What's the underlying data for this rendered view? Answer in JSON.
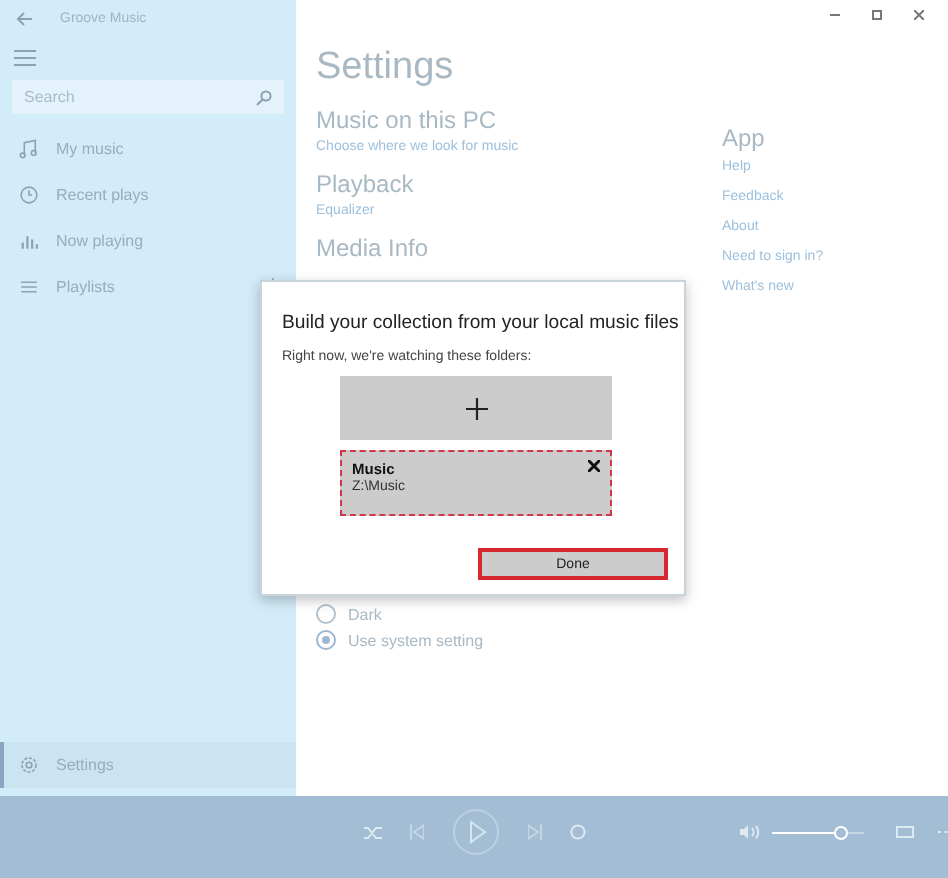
{
  "window": {
    "title": "Groove Music"
  },
  "sidebar": {
    "search": {
      "placeholder": "Search"
    },
    "items": [
      {
        "label": "My music",
        "selected": false
      },
      {
        "label": "Recent plays",
        "selected": false
      },
      {
        "label": "Now playing",
        "selected": false
      },
      {
        "label": "Playlists",
        "selected": false
      }
    ],
    "footer": {
      "label": "Settings",
      "selected": true
    }
  },
  "settings": {
    "heading": "Settings",
    "sections": [
      {
        "title": "Music on this PC",
        "links": [
          "Choose where we look for music"
        ]
      },
      {
        "title": "Playback",
        "links": [
          "Equalizer"
        ]
      },
      {
        "title": "Media Info"
      }
    ],
    "app": {
      "title": "App",
      "links": [
        "Help",
        "Feedback",
        "About",
        "Need to sign in?",
        "What's new"
      ]
    },
    "theme_options": [
      {
        "label": "Dark",
        "selected": false
      },
      {
        "label": "Use system setting",
        "selected": true
      }
    ]
  },
  "dialog": {
    "title": "Build your collection from your local music files",
    "subtitle": "Right now, we're watching these folders:",
    "folders": [
      {
        "name": "Music",
        "path": "Z:\\Music"
      }
    ],
    "done_button": "Done"
  },
  "player": {
    "volume": {
      "level": 0.75
    }
  }
}
